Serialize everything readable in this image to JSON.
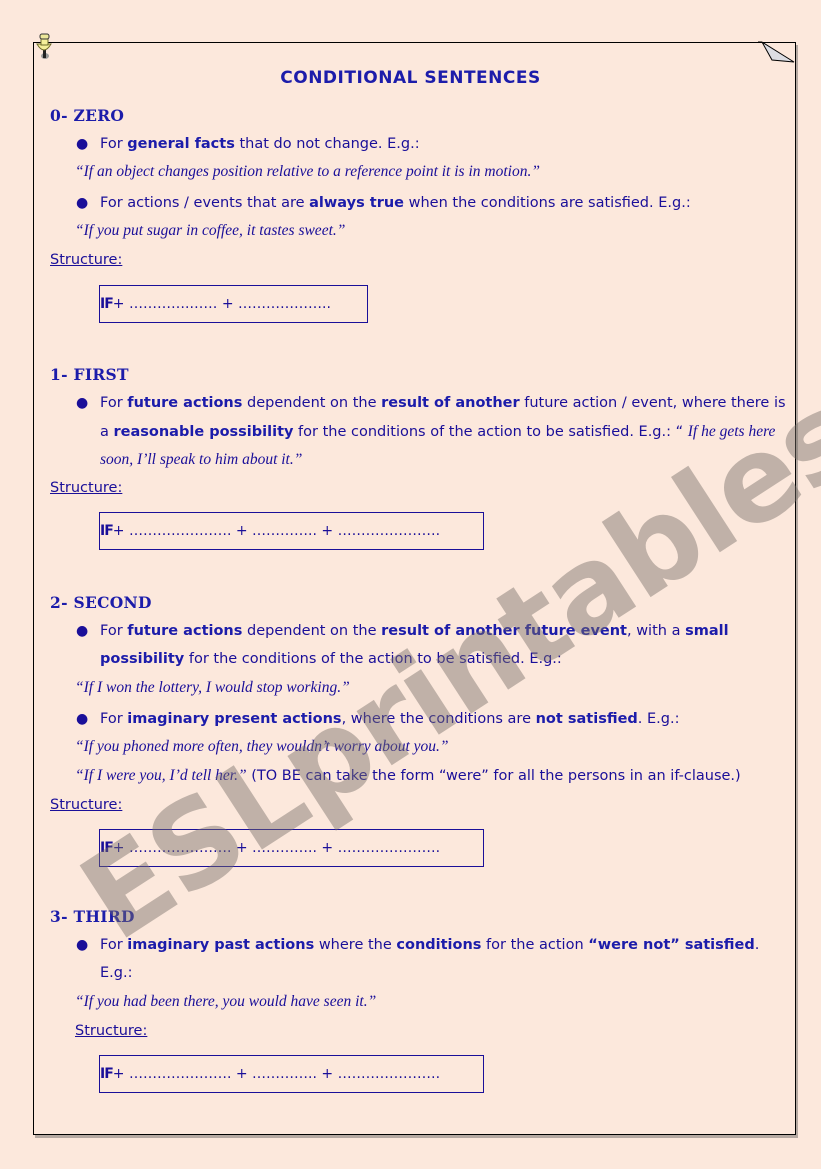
{
  "title": "CONDITIONAL SENTENCES",
  "watermark": "ESLprintables.com",
  "structure_label": "Structure:",
  "sections": [
    {
      "heading": "0- ZERO",
      "b1": {
        "pre": "For ",
        "bold": "general facts",
        "post": " that do not change. E.g.:"
      },
      "ex1": "“If an object changes position relative to a reference point it is in motion.”",
      "b2": {
        "pre": "For actions / events that are ",
        "bold": "always true",
        "post": " when the conditions are satisfied. E.g.:"
      },
      "ex2": "“If you put sugar in coffee, it tastes sweet.”",
      "formula": {
        "if": "IF",
        "rest": " + ………….…… + ……………….."
      }
    },
    {
      "heading": "1- FIRST",
      "line1": {
        "pre": "For ",
        "bold1": "future actions",
        "mid": " dependent on the ",
        "bold2": "result of another",
        "post": " future action / event, where there is"
      },
      "line2": {
        "pre": "a ",
        "bold": "reasonable possibility",
        "mid": " for the conditions of the action to be satisfied. E.g.: “ ",
        "italic": "If he gets here"
      },
      "line3": "soon, I’ll speak to him about it.”",
      "formula": {
        "if": "IF",
        "rest": " + …………………. + ………….. + …………………."
      }
    },
    {
      "heading": "2- SECOND",
      "line1": {
        "pre": "For ",
        "bold1": "future actions",
        "mid": " dependent on the ",
        "bold2": "result of another future event",
        "mid2": ", with a ",
        "bold3": "small"
      },
      "line2": {
        "bold": "possibility",
        "post": " for the conditions of the action to be satisfied. E.g.:"
      },
      "ex1": "“If I won the lottery, I would stop working.”",
      "b2": {
        "pre": "For ",
        "bold1": "imaginary present actions",
        "mid": ", where the conditions are ",
        "bold2": "not satisfied",
        "post": ". E.g.:"
      },
      "ex2": "“If you phoned more often, they wouldn’t worry about you.”",
      "ex3_italic": "“If I were you, I’d tell her.”",
      "ex3_note": " (TO BE can take the form “were” for all the persons in an if-clause.)",
      "formula": {
        "if": "IF",
        "rest": " + …………………. + ………….. + …………………."
      }
    },
    {
      "heading": "3- THIRD",
      "line1": {
        "pre": "For ",
        "bold1": "imaginary past actions",
        "mid": " where the ",
        "bold2": "conditions",
        "mid2": " for the action ",
        "bold3": "“were not” satisfied",
        "post": "."
      },
      "line2": "E.g.:",
      "ex1": "“If you had been there, you would have seen it.”",
      "formula": {
        "if": "IF",
        "rest": " + …………………. + ………….. + …………………."
      }
    }
  ]
}
